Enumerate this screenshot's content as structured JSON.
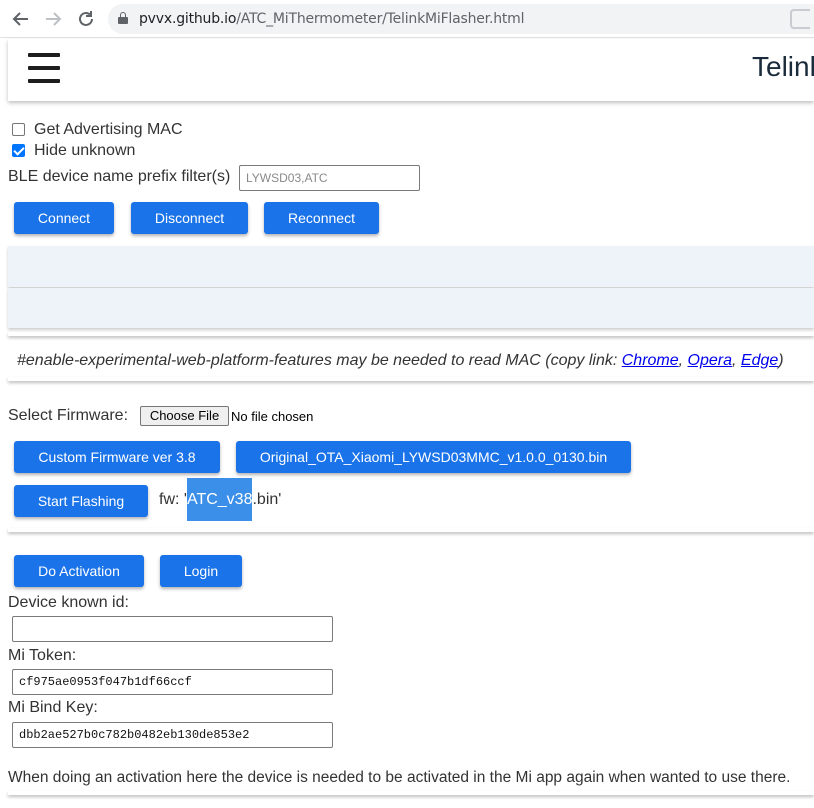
{
  "browser": {
    "url_host": "pvvx.github.io",
    "url_path": "/ATC_MiThermometer/TelinkMiFlasher.html"
  },
  "header": {
    "title": "Telink"
  },
  "options": {
    "get_adv_mac_label": "Get Advertising MAC",
    "get_adv_mac_checked": false,
    "hide_unknown_label": "Hide unknown",
    "hide_unknown_checked": true,
    "prefix_filter_label": "BLE device name prefix filter(s)",
    "prefix_filter_placeholder": "LYWSD03,ATC"
  },
  "connection_buttons": {
    "connect": "Connect",
    "disconnect": "Disconnect",
    "reconnect": "Reconnect"
  },
  "note": {
    "text": "#enable-experimental-web-platform-features may be needed to read MAC (copy link: ",
    "links": [
      "Chrome",
      "Opera",
      "Edge"
    ],
    "sep": ", ",
    "close": ")"
  },
  "firmware": {
    "select_label": "Select Firmware:",
    "choose_file": "Choose File",
    "no_file": "No file chosen",
    "custom_btn": "Custom Firmware ver 3.8",
    "original_btn": "Original_OTA_Xiaomi_LYWSD03MMC_v1.0.0_0130.bin",
    "start_btn": "Start Flashing",
    "fw_prefix": "fw: '",
    "fw_selected": "ATC_v38",
    "fw_suffix": ".bin'"
  },
  "activation": {
    "do_activation_btn": "Do Activation",
    "login_btn": "Login",
    "device_id_label": "Device known id:",
    "device_id_value": "",
    "mi_token_label": "Mi Token:",
    "mi_token_value": "cf975ae0953f047b1df66ccf",
    "bind_key_label": "Mi Bind Key:",
    "bind_key_value": "dbb2ae527b0c782b0482eb130de853e2",
    "footer_note": "When doing an activation here the device is needed to be activated in the Mi app again when wanted to use there."
  },
  "colors": {
    "button_blue": "#1a73e8",
    "panel_bg": "#eef3fa",
    "checkbox_blue": "#0075ff",
    "link_blue": "#0000ee"
  }
}
